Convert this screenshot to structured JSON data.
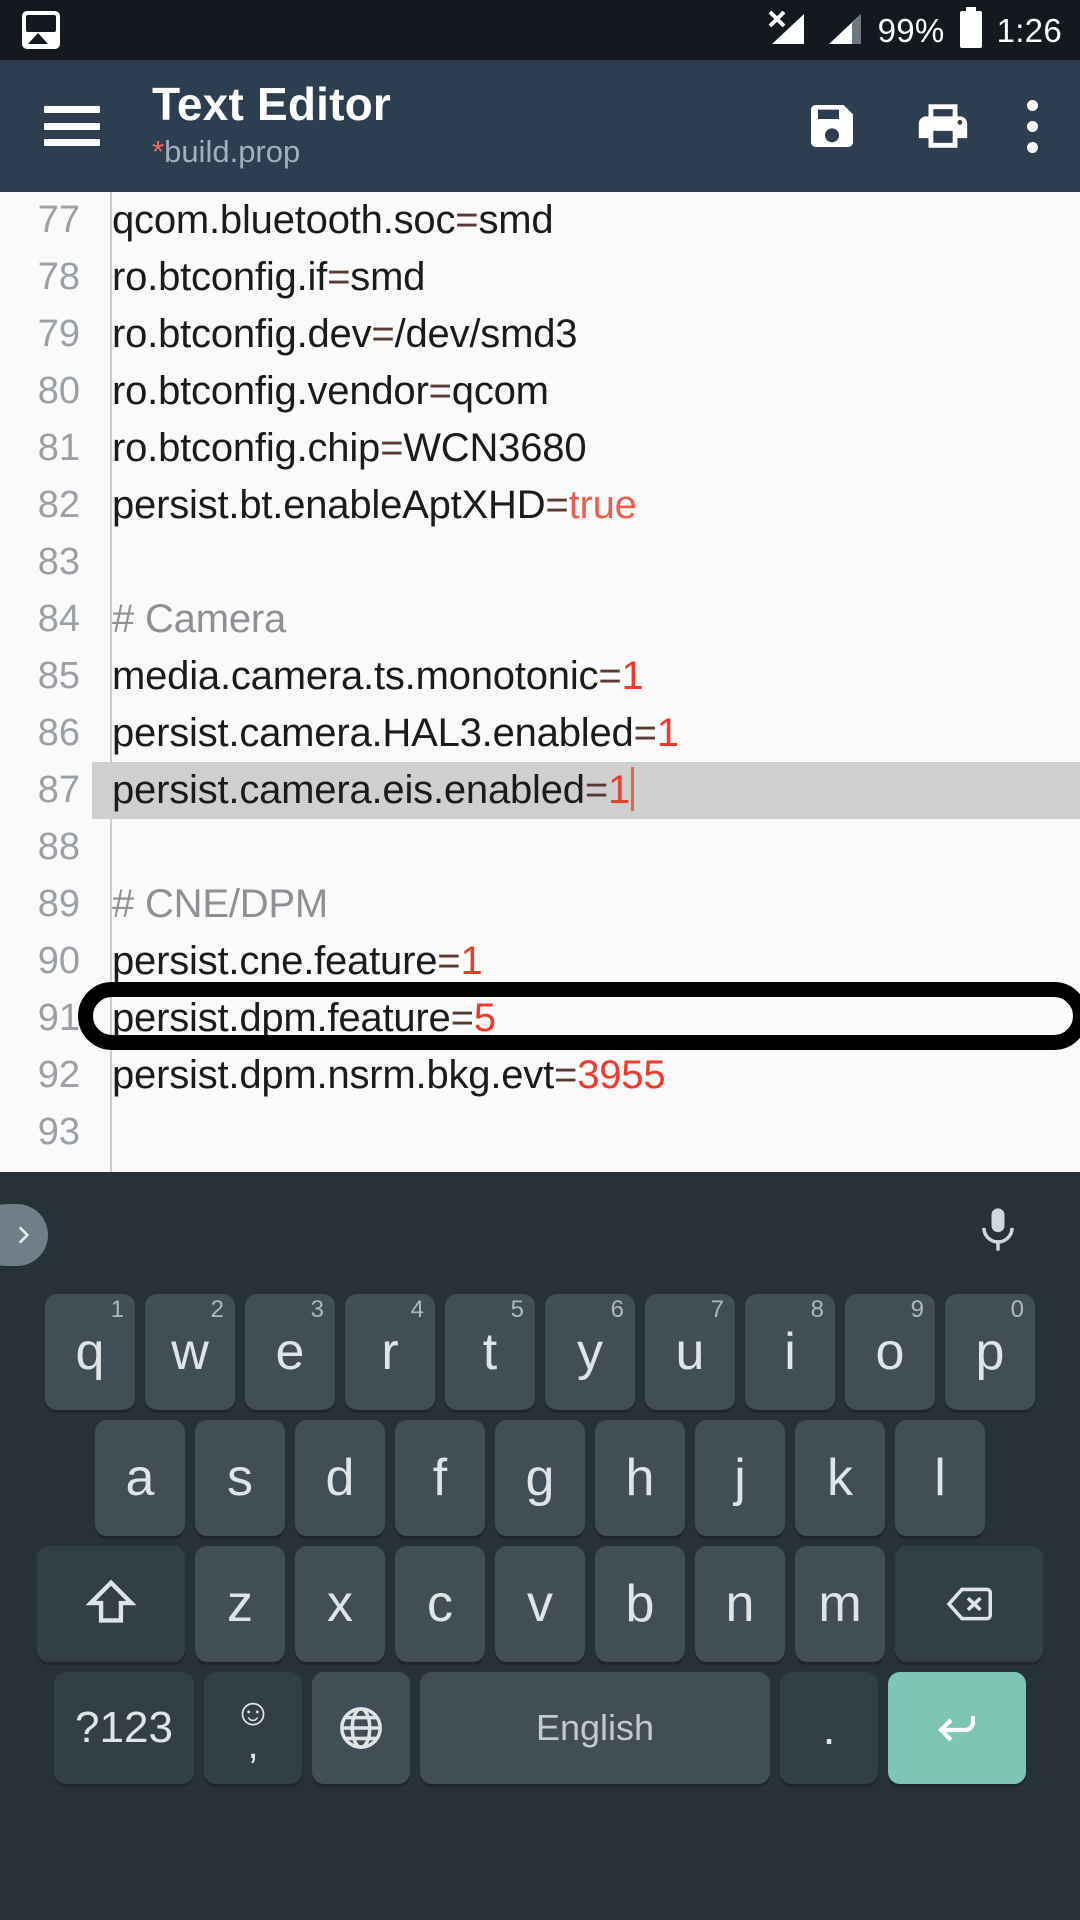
{
  "statusbar": {
    "left_icon": "gallery-icon",
    "signal_icons": [
      "no-sim-signal-icon",
      "signal-bars-icon"
    ],
    "battery_percent": "99%",
    "battery_icon": "battery-full-icon",
    "time": "1:26"
  },
  "appbar": {
    "menu_icon": "hamburger-menu-icon",
    "title": "Text Editor",
    "modified_marker": "*",
    "filename": "build.prop",
    "actions": [
      {
        "name": "save-button",
        "icon": "floppy-disk-icon"
      },
      {
        "name": "print-button",
        "icon": "printer-icon"
      },
      {
        "name": "overflow-menu-button",
        "icon": "kebab-menu-icon"
      }
    ],
    "colors": {
      "bar": "#2d3e50",
      "modified_star": "#e8705a",
      "subtitle": "#9fb0bf"
    }
  },
  "editor": {
    "colors": {
      "background": "#fafafa",
      "line_number": "#9aa0a6",
      "text": "#1b1b1b",
      "comment": "#8d9094",
      "equals": "#5a3b33",
      "value": "#ef3b2d",
      "selection": "#cfcfcf",
      "caret": "#f0624c"
    },
    "lines": [
      {
        "n": "77",
        "key": "qcom.bluetooth.soc",
        "eq": "=",
        "val": "smd",
        "val_style": "plain"
      },
      {
        "n": "78",
        "key": "ro.btconfig.if",
        "eq": "=",
        "val": "smd",
        "val_style": "plain"
      },
      {
        "n": "79",
        "key": "ro.btconfig.dev",
        "eq": "=",
        "val": "/dev/smd3",
        "val_style": "plain"
      },
      {
        "n": "80",
        "key": "ro.btconfig.vendor",
        "eq": "=",
        "val": "qcom",
        "val_style": "plain"
      },
      {
        "n": "81",
        "key": "ro.btconfig.chip",
        "eq": "=",
        "val": "WCN3680",
        "val_style": "plain"
      },
      {
        "n": "82",
        "key": "persist.bt.enableAptXHD",
        "eq": "=",
        "val": "true",
        "val_style": "soft"
      },
      {
        "n": "83",
        "key": "",
        "eq": "",
        "val": "",
        "val_style": "plain"
      },
      {
        "n": "84",
        "key": "",
        "eq": "",
        "val": "",
        "val_style": "comment",
        "comment": "# Camera"
      },
      {
        "n": "85",
        "key": "media.camera.ts.monotonic",
        "eq": "=",
        "val": "1",
        "val_style": "red"
      },
      {
        "n": "86",
        "key": "persist.camera.HAL3.enabled",
        "eq": "=",
        "val": "1",
        "val_style": "red"
      },
      {
        "n": "87",
        "key": "persist.camera.eis.enabled",
        "eq": "=",
        "val": "1",
        "val_style": "red",
        "selected": true,
        "caret": true
      },
      {
        "n": "88",
        "key": "",
        "eq": "",
        "val": "",
        "val_style": "plain"
      },
      {
        "n": "89",
        "key": "",
        "eq": "",
        "val": "",
        "val_style": "comment",
        "comment": "# CNE/DPM"
      },
      {
        "n": "90",
        "key": "persist.cne.feature",
        "eq": "=",
        "val": "1",
        "val_style": "red"
      },
      {
        "n": "91",
        "key": "persist.dpm.feature",
        "eq": "=",
        "val": "5",
        "val_style": "red"
      },
      {
        "n": "92",
        "key": "persist.dpm.nsrm.bkg.evt",
        "eq": "=",
        "val": "3955",
        "val_style": "red"
      },
      {
        "n": "93",
        "key": "",
        "eq": "",
        "val": "",
        "val_style": "plain"
      }
    ],
    "annotation": {
      "name": "highlight-oval",
      "shape": "oval-outline",
      "color": "#000000",
      "target_line": "87"
    }
  },
  "keyboard": {
    "colors": {
      "background": "#263238",
      "key": "#414e56",
      "key_dark": "#333f47",
      "enter": "#7ec5b3",
      "label": "#dfe4e6"
    },
    "toolbar": {
      "expand_icon": "chevron-right-icon",
      "mic_icon": "microphone-icon"
    },
    "row1": [
      {
        "label": "q",
        "sup": "1"
      },
      {
        "label": "w",
        "sup": "2"
      },
      {
        "label": "e",
        "sup": "3"
      },
      {
        "label": "r",
        "sup": "4"
      },
      {
        "label": "t",
        "sup": "5"
      },
      {
        "label": "y",
        "sup": "6"
      },
      {
        "label": "u",
        "sup": "7"
      },
      {
        "label": "i",
        "sup": "8"
      },
      {
        "label": "o",
        "sup": "9"
      },
      {
        "label": "p",
        "sup": "0"
      }
    ],
    "row2": [
      {
        "label": "a"
      },
      {
        "label": "s"
      },
      {
        "label": "d"
      },
      {
        "label": "f"
      },
      {
        "label": "g"
      },
      {
        "label": "h"
      },
      {
        "label": "j"
      },
      {
        "label": "k"
      },
      {
        "label": "l"
      }
    ],
    "row3": [
      {
        "label": "",
        "icon": "shift-icon",
        "wide": true
      },
      {
        "label": "z"
      },
      {
        "label": "x"
      },
      {
        "label": "c"
      },
      {
        "label": "v"
      },
      {
        "label": "b"
      },
      {
        "label": "n"
      },
      {
        "label": "m"
      },
      {
        "label": "",
        "icon": "backspace-icon",
        "wide": true
      }
    ],
    "row4": {
      "symbols_label": "?123",
      "emoji_icon": "emoji-smiley-icon",
      "comma_label": ",",
      "globe_icon": "language-globe-icon",
      "space_label": "English",
      "period_label": ".",
      "enter_icon": "enter-return-icon"
    }
  }
}
